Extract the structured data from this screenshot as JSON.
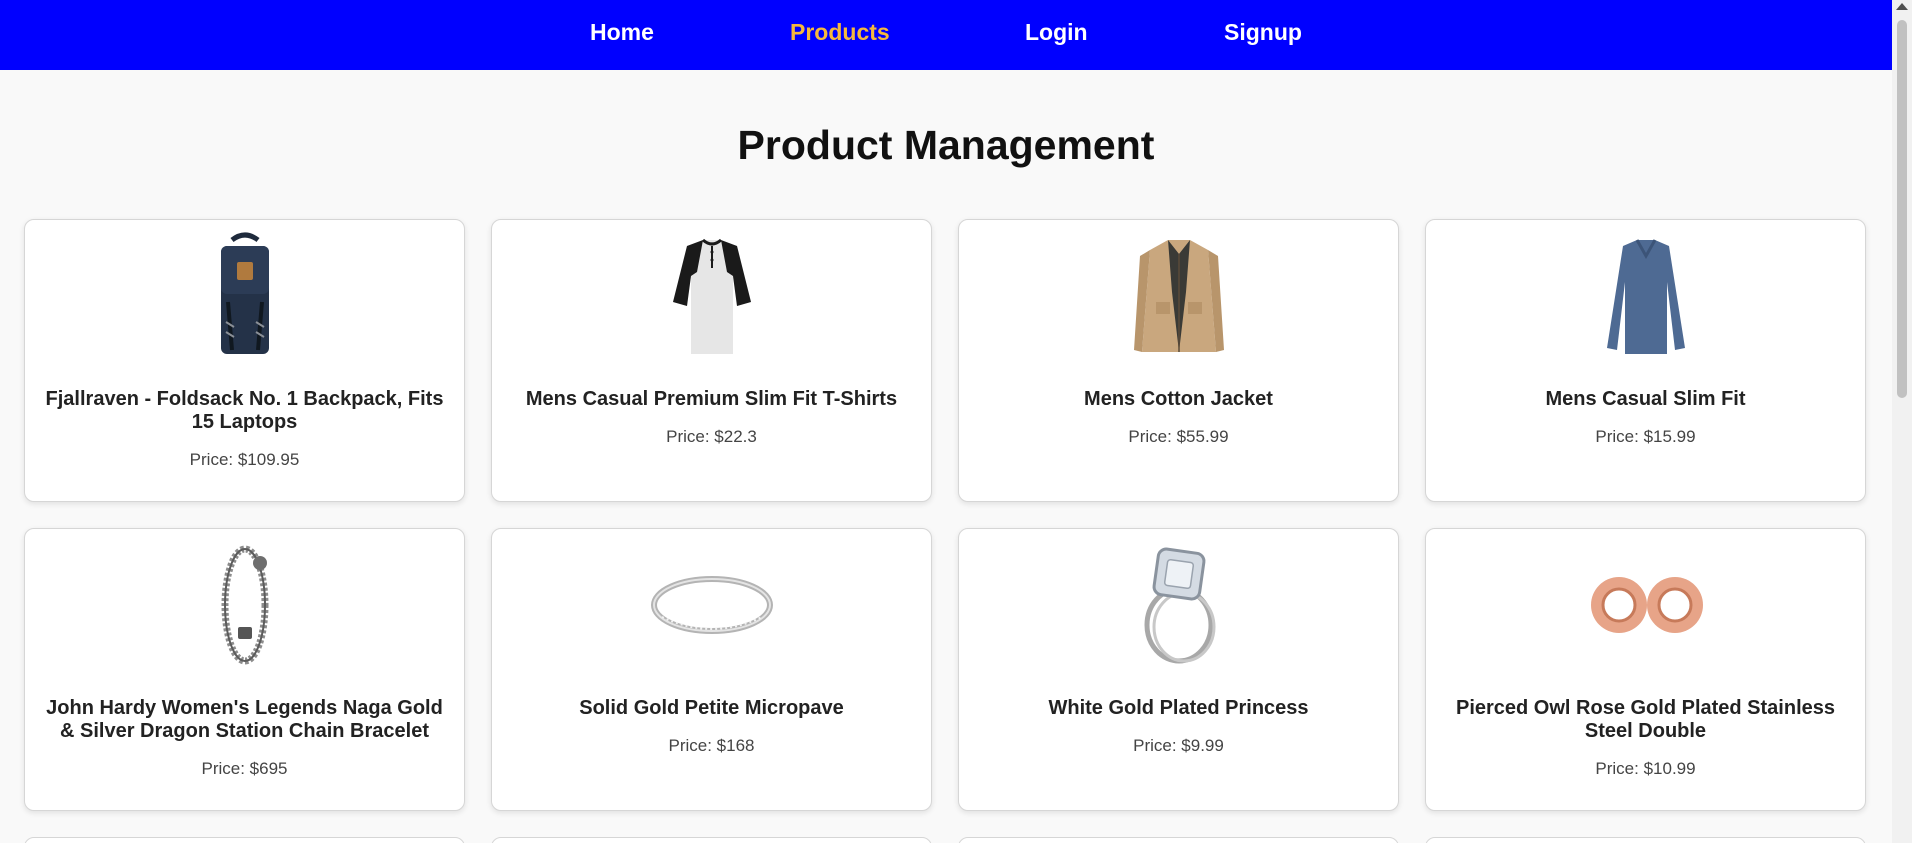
{
  "nav": {
    "items": [
      {
        "label": "Home",
        "active": false
      },
      {
        "label": "Products",
        "active": true
      },
      {
        "label": "Login",
        "active": false
      },
      {
        "label": "Signup",
        "active": false
      }
    ]
  },
  "colors": {
    "nav_bg": "#0000ff",
    "nav_active": "#f5b83d",
    "nav_text": "#ffffff"
  },
  "page_title": "Product Management",
  "products": [
    {
      "title": "Fjallraven - Foldsack No. 1 Backpack, Fits 15 Laptops",
      "price": "Price: $109.95",
      "icon": "backpack-image"
    },
    {
      "title": "Mens Casual Premium Slim Fit T-Shirts",
      "price": "Price: $22.3",
      "icon": "tshirt-image"
    },
    {
      "title": "Mens Cotton Jacket",
      "price": "Price: $55.99",
      "icon": "jacket-image"
    },
    {
      "title": "Mens Casual Slim Fit",
      "price": "Price: $15.99",
      "icon": "longsleeve-image"
    },
    {
      "title": "John Hardy Women's Legends Naga Gold & Silver Dragon Station Chain Bracelet",
      "price": "Price: $695",
      "icon": "bracelet-image"
    },
    {
      "title": "Solid Gold Petite Micropave",
      "price": "Price: $168",
      "icon": "ring-image"
    },
    {
      "title": "White Gold Plated Princess",
      "price": "Price: $9.99",
      "icon": "diamond-ring-image"
    },
    {
      "title": "Pierced Owl Rose Gold Plated Stainless Steel Double",
      "price": "Price: $10.99",
      "icon": "plugs-image"
    }
  ]
}
